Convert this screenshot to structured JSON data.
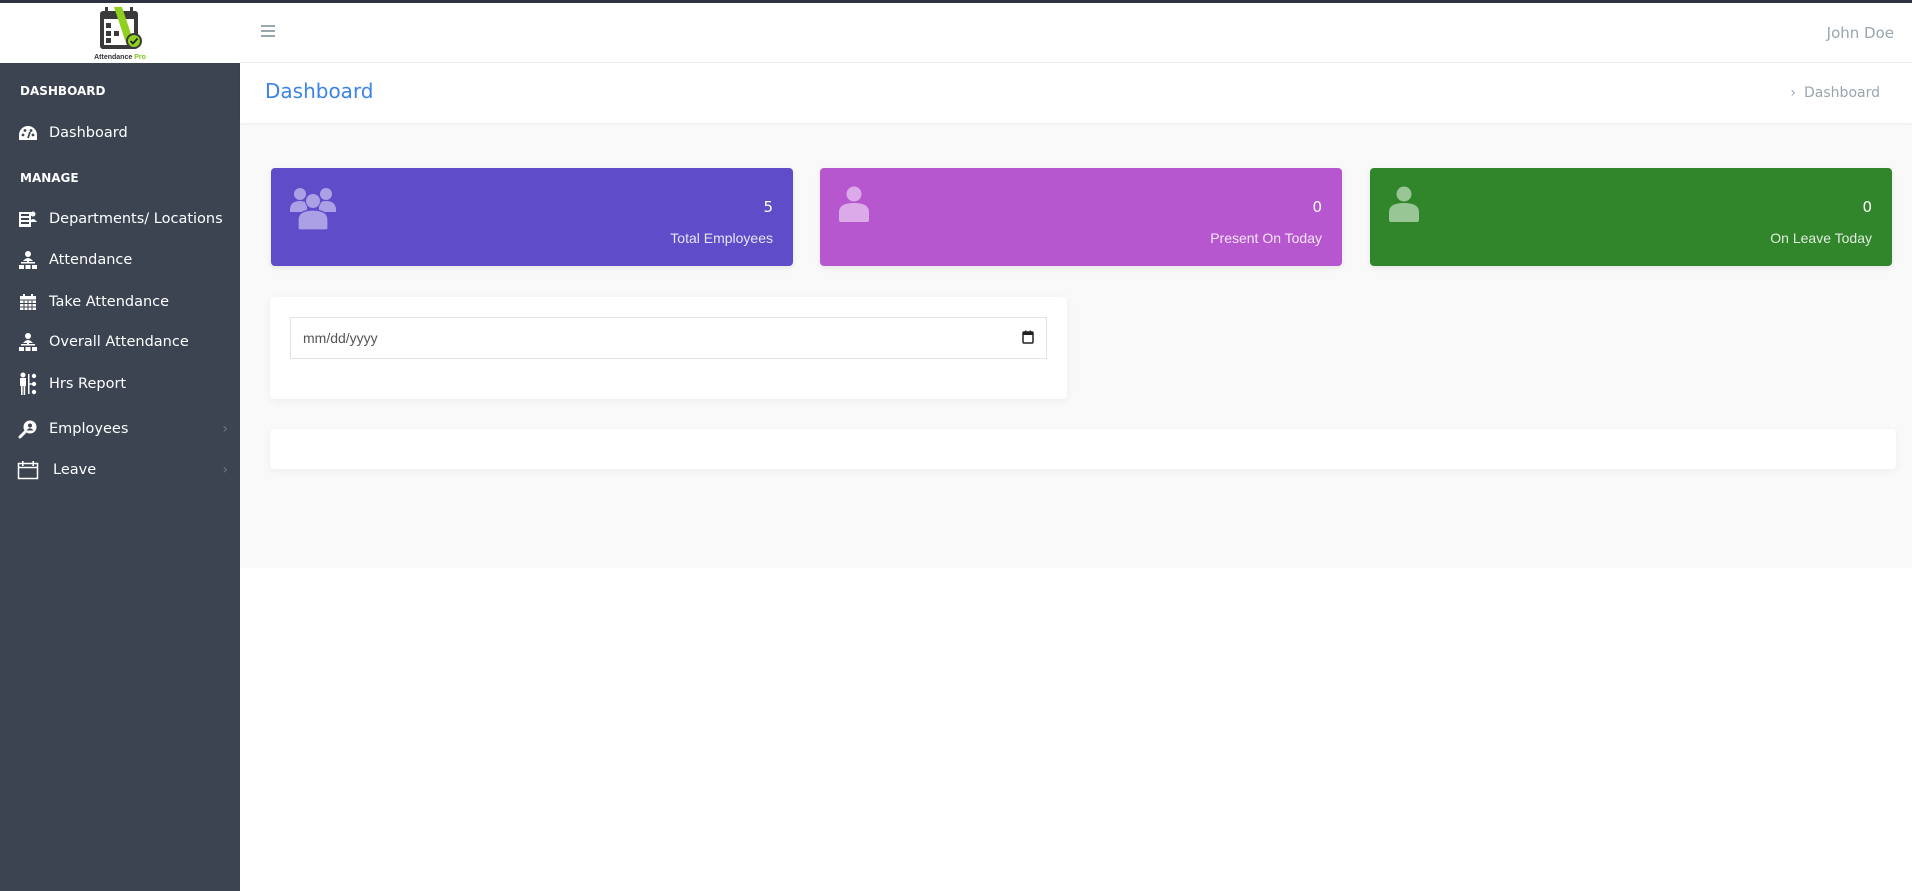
{
  "app": {
    "logo_text": "Attendance",
    "logo_text_accent": "Pro",
    "user_name": "John Doe"
  },
  "sidebar": {
    "sections": [
      {
        "title": "DASHBOARD"
      },
      {
        "title": "MANAGE"
      }
    ],
    "items": [
      {
        "label": "Dashboard",
        "icon": "dashboard-icon"
      },
      {
        "label": "Departments/ Locations",
        "icon": "departments-icon"
      },
      {
        "label": "Attendance",
        "icon": "org-chart-icon"
      },
      {
        "label": "Take Attendance",
        "icon": "calendar-grid-icon"
      },
      {
        "label": "Overall Attendance",
        "icon": "org-chart-icon"
      },
      {
        "label": "Hrs Report",
        "icon": "hrs-report-icon"
      },
      {
        "label": "Employees",
        "icon": "search-user-icon",
        "has_submenu": true
      },
      {
        "label": "Leave",
        "icon": "calendar-icon",
        "has_submenu": true
      }
    ]
  },
  "page": {
    "title": "Dashboard",
    "breadcrumb": [
      "Dashboard"
    ]
  },
  "stats": [
    {
      "value": "5",
      "label": "Total Employees",
      "icon": "users-icon",
      "color": "#5e4cc8"
    },
    {
      "value": "0",
      "label": "Present On Today",
      "icon": "user-icon",
      "color": "#b757d0"
    },
    {
      "value": "0",
      "label": "On Leave Today",
      "icon": "user-icon",
      "color": "#31852b"
    }
  ],
  "filter": {
    "date_placeholder": "mm/dd/yyyy",
    "date_value": ""
  },
  "colors": {
    "sidebar_bg": "#3c4451",
    "accent": "#3b84e6",
    "muted": "#98a6ad"
  }
}
